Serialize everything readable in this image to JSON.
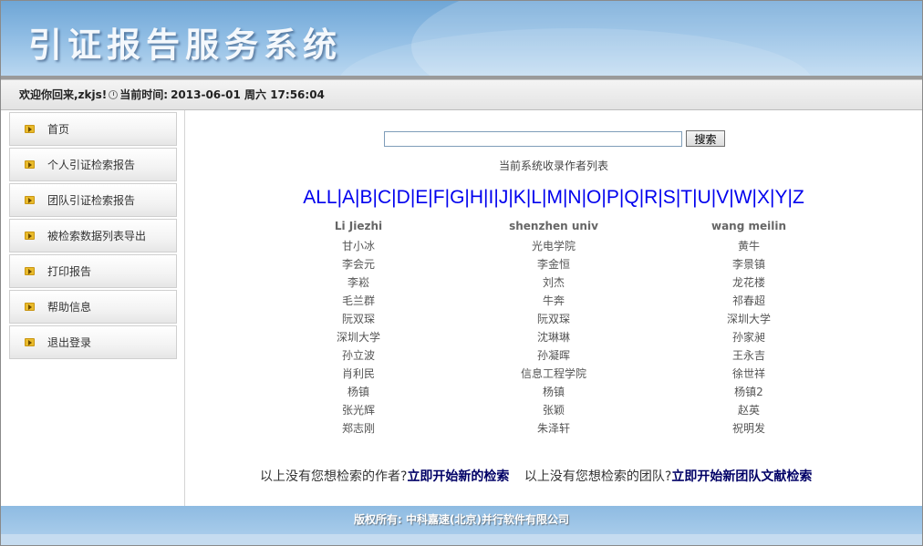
{
  "header": {
    "title": "引证报告服务系统"
  },
  "status": {
    "welcome": "欢迎你回来,zkjs!",
    "time_label": "当前时间:",
    "time_value": "2013-06-01 周六 17:56:04"
  },
  "sidebar": {
    "items": [
      {
        "label": "首页"
      },
      {
        "label": "个人引证检索报告"
      },
      {
        "label": "团队引证检索报告"
      },
      {
        "label": "被检索数据列表导出"
      },
      {
        "label": "打印报告"
      },
      {
        "label": "帮助信息"
      },
      {
        "label": "退出登录"
      }
    ]
  },
  "search": {
    "value": "",
    "placeholder": "",
    "button_label": "搜索"
  },
  "list_caption": "当前系统收录作者列表",
  "alphabet": [
    "ALL",
    "A",
    "B",
    "C",
    "D",
    "E",
    "F",
    "G",
    "H",
    "I",
    "J",
    "K",
    "L",
    "M",
    "N",
    "O",
    "P",
    "Q",
    "R",
    "S",
    "T",
    "U",
    "V",
    "W",
    "X",
    "Y",
    "Z"
  ],
  "authors": {
    "columns": [
      {
        "header": "Li Jiezhi",
        "items": [
          "甘小冰",
          "李会元",
          "李崧",
          "毛兰群",
          "阮双琛",
          "深圳大学",
          "孙立波",
          "肖利民",
          "杨镇",
          "张光辉",
          "郑志刚"
        ]
      },
      {
        "header": "shenzhen univ",
        "items": [
          "光电学院",
          "李金恒",
          "刘杰",
          "牛奔",
          "阮双琛",
          "沈琳琳",
          "孙凝晖",
          "信息工程学院",
          "杨镇",
          "张颖",
          "朱泽轩"
        ]
      },
      {
        "header": "wang meilin",
        "items": [
          "黄牛",
          "李景镇",
          "龙花楼",
          "祁春超",
          "深圳大学",
          "孙家昶",
          "王永吉",
          "徐世祥",
          "杨镇2",
          "赵英",
          "祝明发"
        ]
      }
    ]
  },
  "prompts": {
    "author_text": "以上没有您想检索的作者?",
    "author_link": "立即开始新的检索",
    "team_text": "以上没有您想检索的团队?",
    "team_link": "立即开始新团队文献检索"
  },
  "footer": {
    "copyright": "版权所有: 中科嘉速(北京)并行软件有限公司"
  }
}
